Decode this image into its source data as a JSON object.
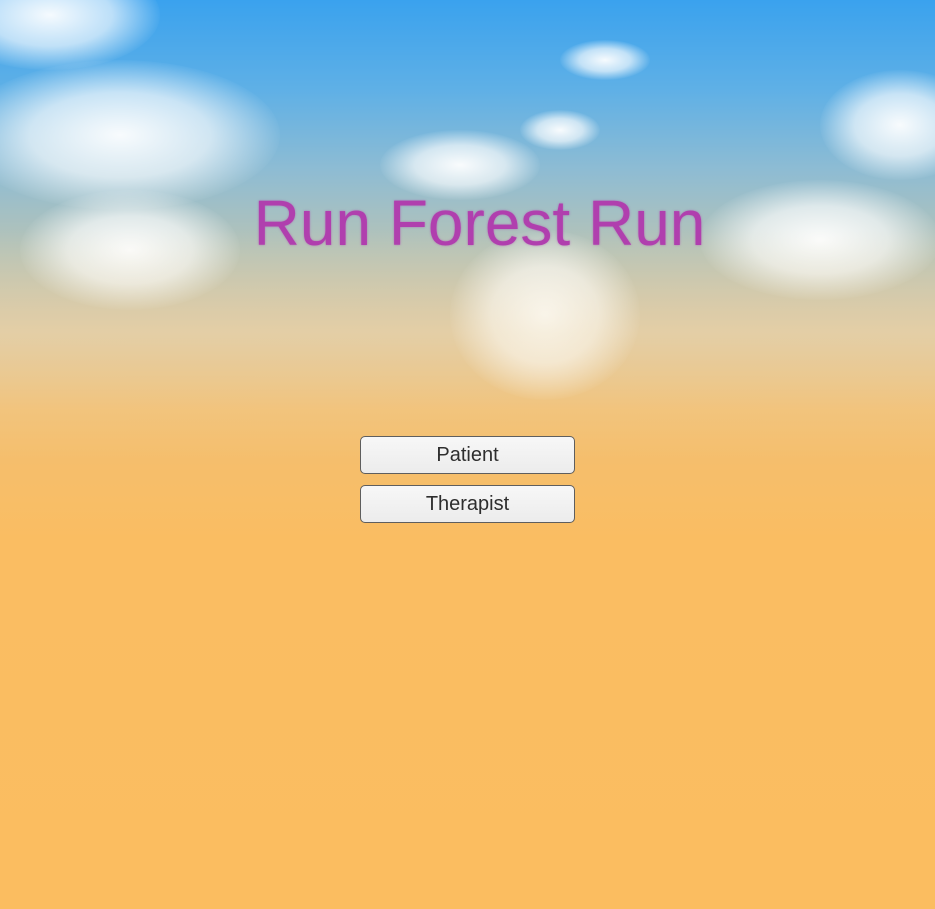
{
  "game": {
    "title": "Run Forest Run"
  },
  "menu": {
    "buttons": [
      {
        "label": "Patient"
      },
      {
        "label": "Therapist"
      }
    ]
  },
  "colors": {
    "title": "#b03fae",
    "sky_top": "#3aa2ee",
    "ground": "#fbbd60",
    "button_bg": "#f3f3f3",
    "button_border": "#5e5e5e"
  }
}
